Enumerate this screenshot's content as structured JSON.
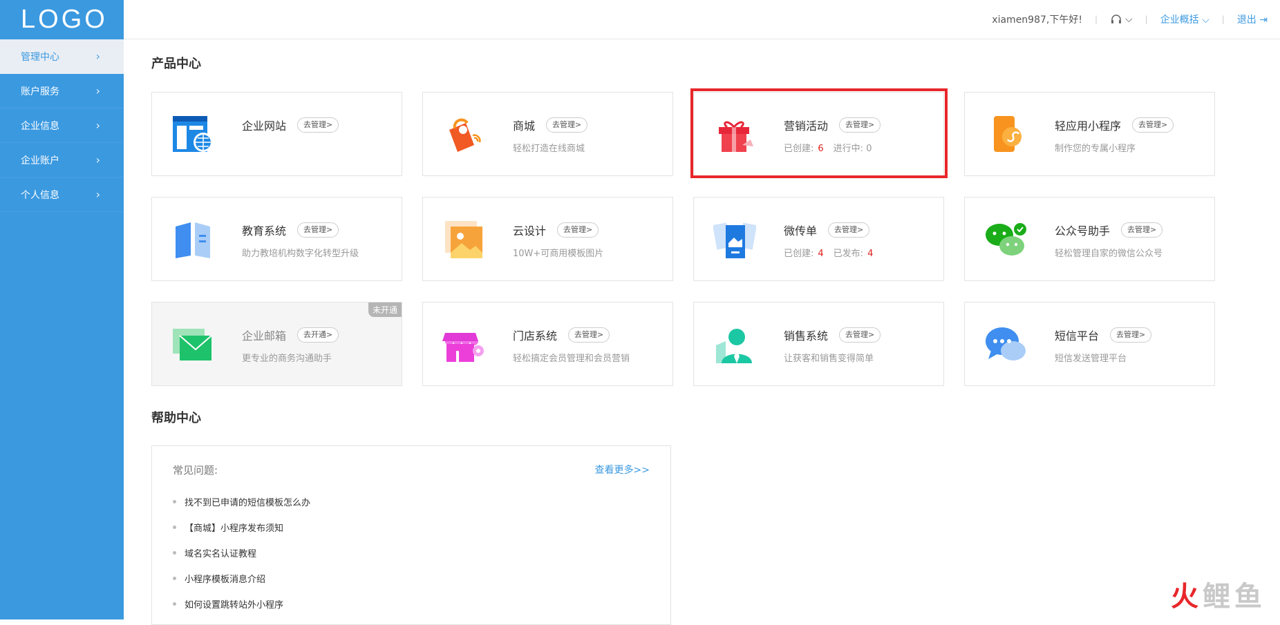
{
  "logo": "LOGO",
  "sidebar": {
    "items": [
      {
        "label": "管理中心"
      },
      {
        "label": "账户服务"
      },
      {
        "label": "企业信息"
      },
      {
        "label": "企业账户"
      },
      {
        "label": "个人信息"
      }
    ]
  },
  "topbar": {
    "greeting": "xiamen987,下午好!",
    "overview": "企业概括",
    "logout": "退出"
  },
  "products": {
    "title": "产品中心",
    "cards": [
      {
        "name": "企业网站",
        "btn": "去管理>",
        "desc": ""
      },
      {
        "name": "商城",
        "btn": "去管理>",
        "desc": "轻松打造在线商城"
      },
      {
        "name": "营销活动",
        "btn": "去管理>",
        "stat1_label": "已创建:",
        "stat1": "6",
        "stat2_label": "进行中:",
        "stat2": "0"
      },
      {
        "name": "轻应用小程序",
        "btn": "去管理>",
        "desc": "制作您的专属小程序"
      },
      {
        "name": "教育系统",
        "btn": "去管理>",
        "desc": "助力教培机构数字化转型升级"
      },
      {
        "name": "云设计",
        "btn": "去管理>",
        "desc": "10W+可商用模板图片"
      },
      {
        "name": "微传单",
        "btn": "去管理>",
        "stat1_label": "已创建:",
        "stat1": "4",
        "stat2_label": "已发布:",
        "stat2": "4"
      },
      {
        "name": "公众号助手",
        "btn": "去管理>",
        "desc": "轻松管理自家的微信公众号"
      },
      {
        "name": "企业邮箱",
        "btn": "去开通>",
        "desc": "更专业的商务沟通助手",
        "ribbon": "未开通"
      },
      {
        "name": "门店系统",
        "btn": "去管理>",
        "desc": "轻松搞定会员管理和会员营销"
      },
      {
        "name": "销售系统",
        "btn": "去管理>",
        "desc": "让获客和销售变得简单"
      },
      {
        "name": "短信平台",
        "btn": "去管理>",
        "desc": "短信发送管理平台"
      }
    ]
  },
  "help": {
    "title": "帮助中心",
    "faq_title": "常见问题:",
    "more": "查看更多>>",
    "items": [
      "找不到已申请的短信模板怎么办",
      "【商城】小程序发布须知",
      "域名实名认证教程",
      "小程序模板消息介绍",
      "如何设置跳转站外小程序"
    ]
  },
  "watermark": {
    "first": "火",
    "rest": "鲤鱼"
  },
  "colors": {
    "sidebar": "#3b99e0",
    "accent": "#3b99e0",
    "highlight": "#e8262a",
    "stat": "#e02020"
  }
}
